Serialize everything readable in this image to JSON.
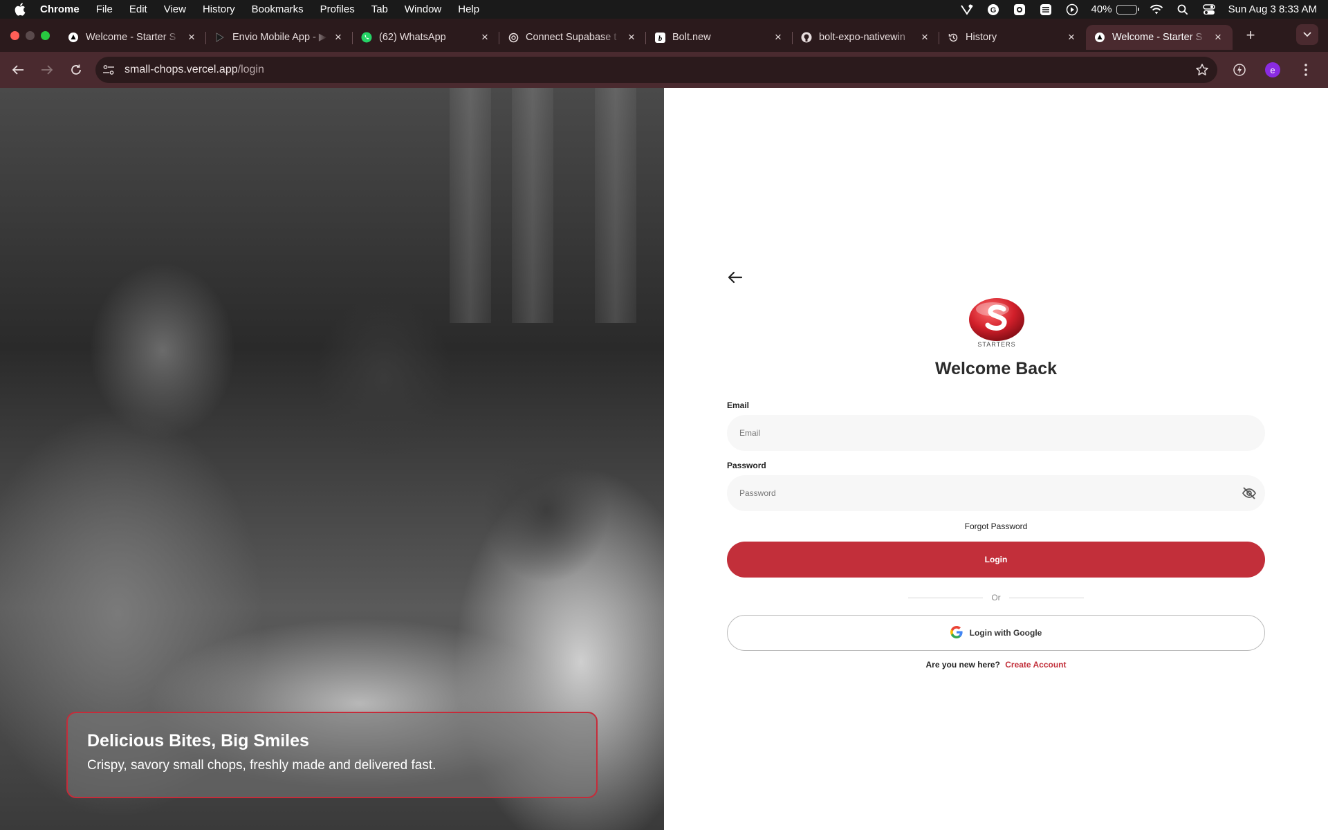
{
  "menubar": {
    "app_name": "Chrome",
    "items": [
      "File",
      "Edit",
      "View",
      "History",
      "Bookmarks",
      "Profiles",
      "Tab",
      "Window",
      "Help"
    ],
    "battery_percent": "40%",
    "battery_level": 0.4,
    "datetime": "Sun Aug 3  8:33 AM"
  },
  "tabs": [
    {
      "title": "Welcome - Starter S",
      "icon": "vercel-triangle-icon",
      "active": false
    },
    {
      "title": "Envio Mobile App - ▶",
      "icon": "play-icon",
      "active": false
    },
    {
      "title": "(62) WhatsApp",
      "icon": "whatsapp-icon",
      "active": false
    },
    {
      "title": "Connect Supabase t",
      "icon": "openai-icon",
      "active": false
    },
    {
      "title": "Bolt.new",
      "icon": "bolt-icon",
      "active": false
    },
    {
      "title": "bolt-expo-nativewin",
      "icon": "github-icon",
      "active": false
    },
    {
      "title": "History",
      "icon": "history-icon",
      "active": false
    },
    {
      "title": "Welcome - Starter S",
      "icon": "vercel-triangle-icon",
      "active": true
    }
  ],
  "toolbar": {
    "url_host": "small-chops.vercel.app",
    "url_path": "/login",
    "profile_initial": "e"
  },
  "hero": {
    "headline": "Delicious Bites, Big Smiles",
    "subline": "Crispy, savory small chops, freshly made and delivered fast."
  },
  "login": {
    "title": "Welcome Back",
    "email_label": "Email",
    "email_placeholder": "Email",
    "password_label": "Password",
    "password_placeholder": "Password",
    "forgot": "Forgot Password",
    "login_button": "Login",
    "or": "Or",
    "google_button": "Login with Google",
    "signup_prompt": "Are you new here?",
    "signup_link": "Create Account",
    "logo_text": "STARTERS"
  },
  "colors": {
    "brand_red": "#c22f3a",
    "chrome_frame": "#2b1a1c",
    "chrome_toolbar": "#4a2a2f"
  }
}
